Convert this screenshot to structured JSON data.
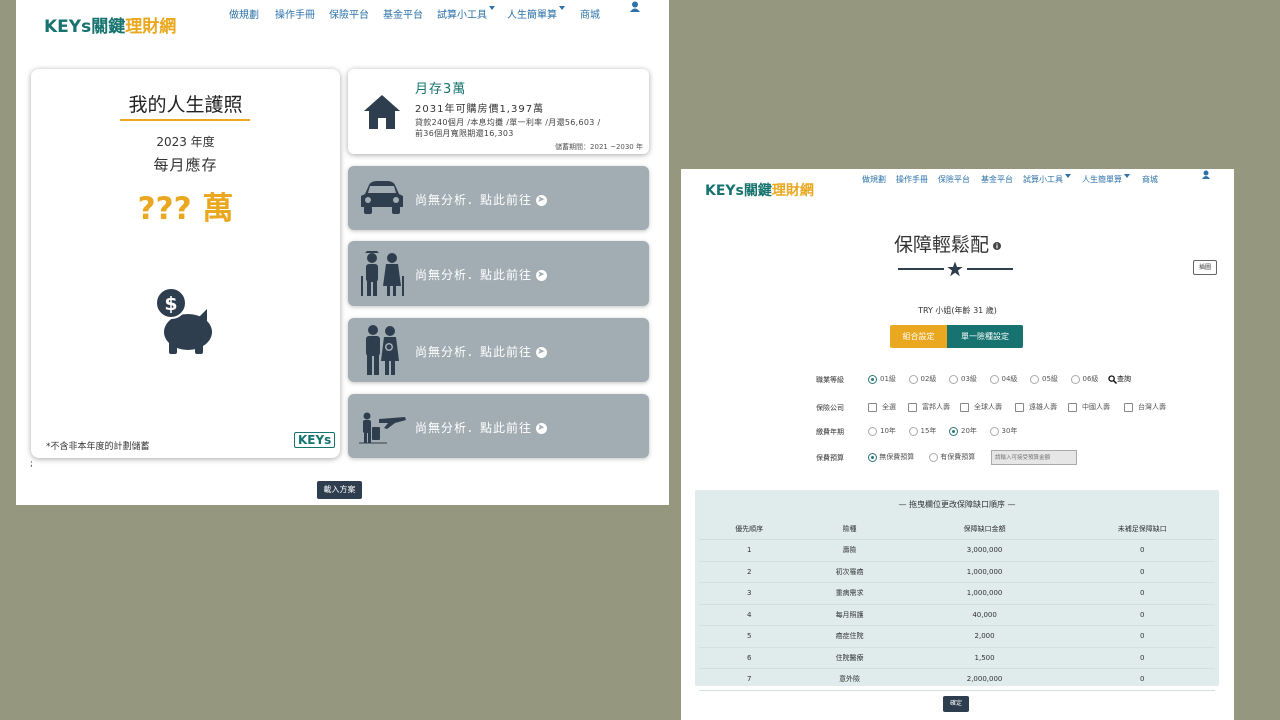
{
  "left": {
    "logo": {
      "keys": "KEYs",
      "cjk_a": "關鍵",
      "cjk_b": "理財網"
    },
    "nav": [
      {
        "label": "做規劃"
      },
      {
        "label": "操作手冊"
      },
      {
        "label": "保險平台"
      },
      {
        "label": "基金平台"
      },
      {
        "label": "試算小工具",
        "dropdown": true
      },
      {
        "label": "人生簡單算",
        "dropdown": true
      },
      {
        "label": "商城"
      }
    ],
    "passport": {
      "title": "我的人生護照",
      "year": "2023 年度",
      "monthly_label": "每月應存",
      "amount": "??? 萬",
      "footnote": "*不含非本年度的計劃儲蓄",
      "badge": "KEYs"
    },
    "house_card": {
      "title": "月存3萬",
      "line1": "2031年可購房價1,397萬",
      "line2": "貸款240個月 /本息均攤 /單一利率 /月還56,603 /",
      "line3": "前36個月寬限期還16,303",
      "period": "儲蓄期間：2021 ~2030 年"
    },
    "empty_cards": [
      {
        "text": "尚無分析．點此前往",
        "icon": "car-icon"
      },
      {
        "text": "尚無分析．點此前往",
        "icon": "elderly-couple-icon"
      },
      {
        "text": "尚無分析．點此前往",
        "icon": "family-icon"
      },
      {
        "text": "尚無分析．點此前往",
        "icon": "travel-icon"
      }
    ],
    "stray": ";",
    "load_button": "載入方案"
  },
  "right": {
    "logo": {
      "keys": "KEYs",
      "cjk_a": "關鍵",
      "cjk_b": "理財網"
    },
    "nav": [
      {
        "label": "做規劃"
      },
      {
        "label": "操作手冊"
      },
      {
        "label": "保險平台"
      },
      {
        "label": "基金平台"
      },
      {
        "label": "試算小工具",
        "dropdown": true
      },
      {
        "label": "人生簡單算",
        "dropdown": true
      },
      {
        "label": "商城"
      }
    ],
    "heading": "保障輕鬆配",
    "chart_button": "插圖",
    "user": "TRY 小姐(年齡 31 歲)",
    "tab_combo": "組合設定",
    "tab_single": "單一險種設定",
    "job_level": {
      "label": "職業等級",
      "options": [
        "01級",
        "02級",
        "03級",
        "04級",
        "05級",
        "06級"
      ],
      "selected": 0,
      "lookup": "查詢"
    },
    "company": {
      "label": "保險公司",
      "options": [
        "全選",
        "富邦人壽",
        "全球人壽",
        "遠雄人壽",
        "中國人壽",
        "台灣人壽"
      ]
    },
    "term": {
      "label": "繳費年期",
      "options": [
        "10年",
        "15年",
        "20年",
        "30年"
      ],
      "selected": 2
    },
    "budget": {
      "label": "保費預算",
      "opt_none": "無保費預算",
      "opt_has": "有保費預算",
      "placeholder": "請輸入可接受預算金額"
    },
    "table": {
      "caption": "— 拖曳欄位更改保障缺口順序 —",
      "headers": [
        "優先順序",
        "險種",
        "保障缺口金額",
        "未補足保障缺口"
      ],
      "rows": [
        [
          "1",
          "壽險",
          "3,000,000",
          "0"
        ],
        [
          "2",
          "初次罹癌",
          "1,000,000",
          "0"
        ],
        [
          "3",
          "重病需求",
          "1,000,000",
          "0"
        ],
        [
          "4",
          "每月照護",
          "40,000",
          "0"
        ],
        [
          "5",
          "癌症住院",
          "2,000",
          "0"
        ],
        [
          "6",
          "住院醫療",
          "1,500",
          "0"
        ],
        [
          "7",
          "意外險",
          "2,000,000",
          "0"
        ]
      ]
    },
    "confirm": "確定"
  },
  "colors": {
    "teal": "#16736f",
    "gold": "#e9a81f",
    "slate": "#2f3e4e",
    "card_gray": "#a2adb3"
  }
}
